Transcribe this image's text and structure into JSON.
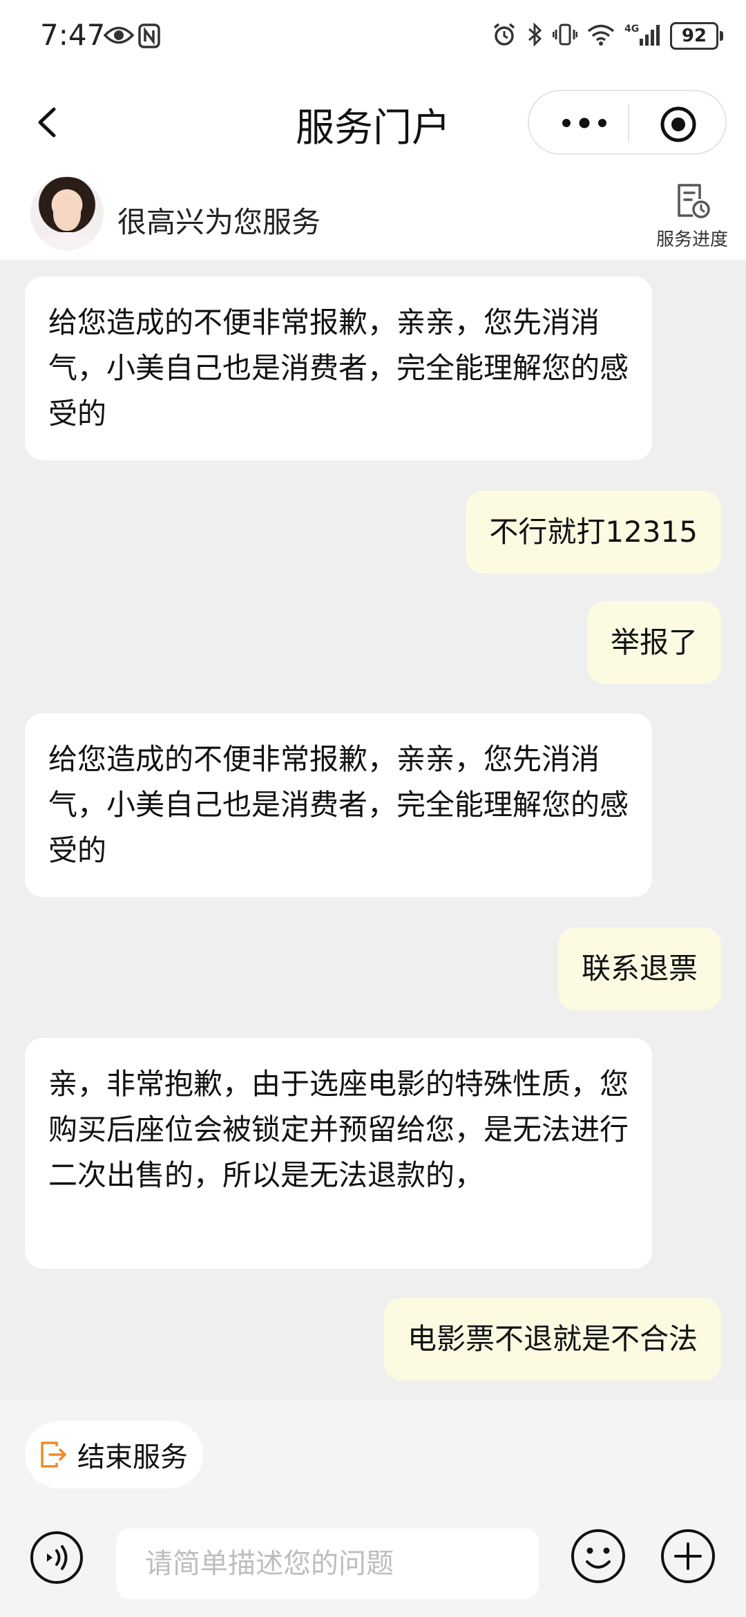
{
  "status_bar": {
    "time": "7:47",
    "network": "4G",
    "battery": "92"
  },
  "nav": {
    "title": "服务门户"
  },
  "agent": {
    "greeting": "很高兴为您服务",
    "progress_label": "服务进度"
  },
  "messages": [
    {
      "side": "left",
      "text": "给您造成的不便非常报歉，亲亲，您先消消气，小美自己也是消费者，完全能理解您的感受的"
    },
    {
      "side": "right",
      "text": "不行就打12315"
    },
    {
      "side": "right",
      "text": "举报了"
    },
    {
      "side": "left",
      "text": "给您造成的不便非常报歉，亲亲，您先消消气，小美自己也是消费者，完全能理解您的感受的"
    },
    {
      "side": "right",
      "text": "联系退票"
    },
    {
      "side": "left",
      "text": "亲，非常抱歉，由于选座电影的特殊性质，您购买后座位会被锁定并预留给您，是无法进行二次出售的，所以是无法退款的，"
    },
    {
      "side": "right",
      "text": "电影票不退就是不合法"
    }
  ],
  "bottom": {
    "end_service_label": "结束服务",
    "input_placeholder": "请简单描述您的问题",
    "input_value": ""
  },
  "colors": {
    "agent_bubble": "#ffffff",
    "user_bubble": "#fcfbe2",
    "chat_background": "#efefef",
    "end_service_icon": "#f08a24"
  },
  "icons": [
    "back-arrow-icon",
    "more-dots-icon",
    "target-icon",
    "service-progress-icon",
    "exit-icon",
    "voice-icon",
    "emoji-icon",
    "plus-icon"
  ]
}
